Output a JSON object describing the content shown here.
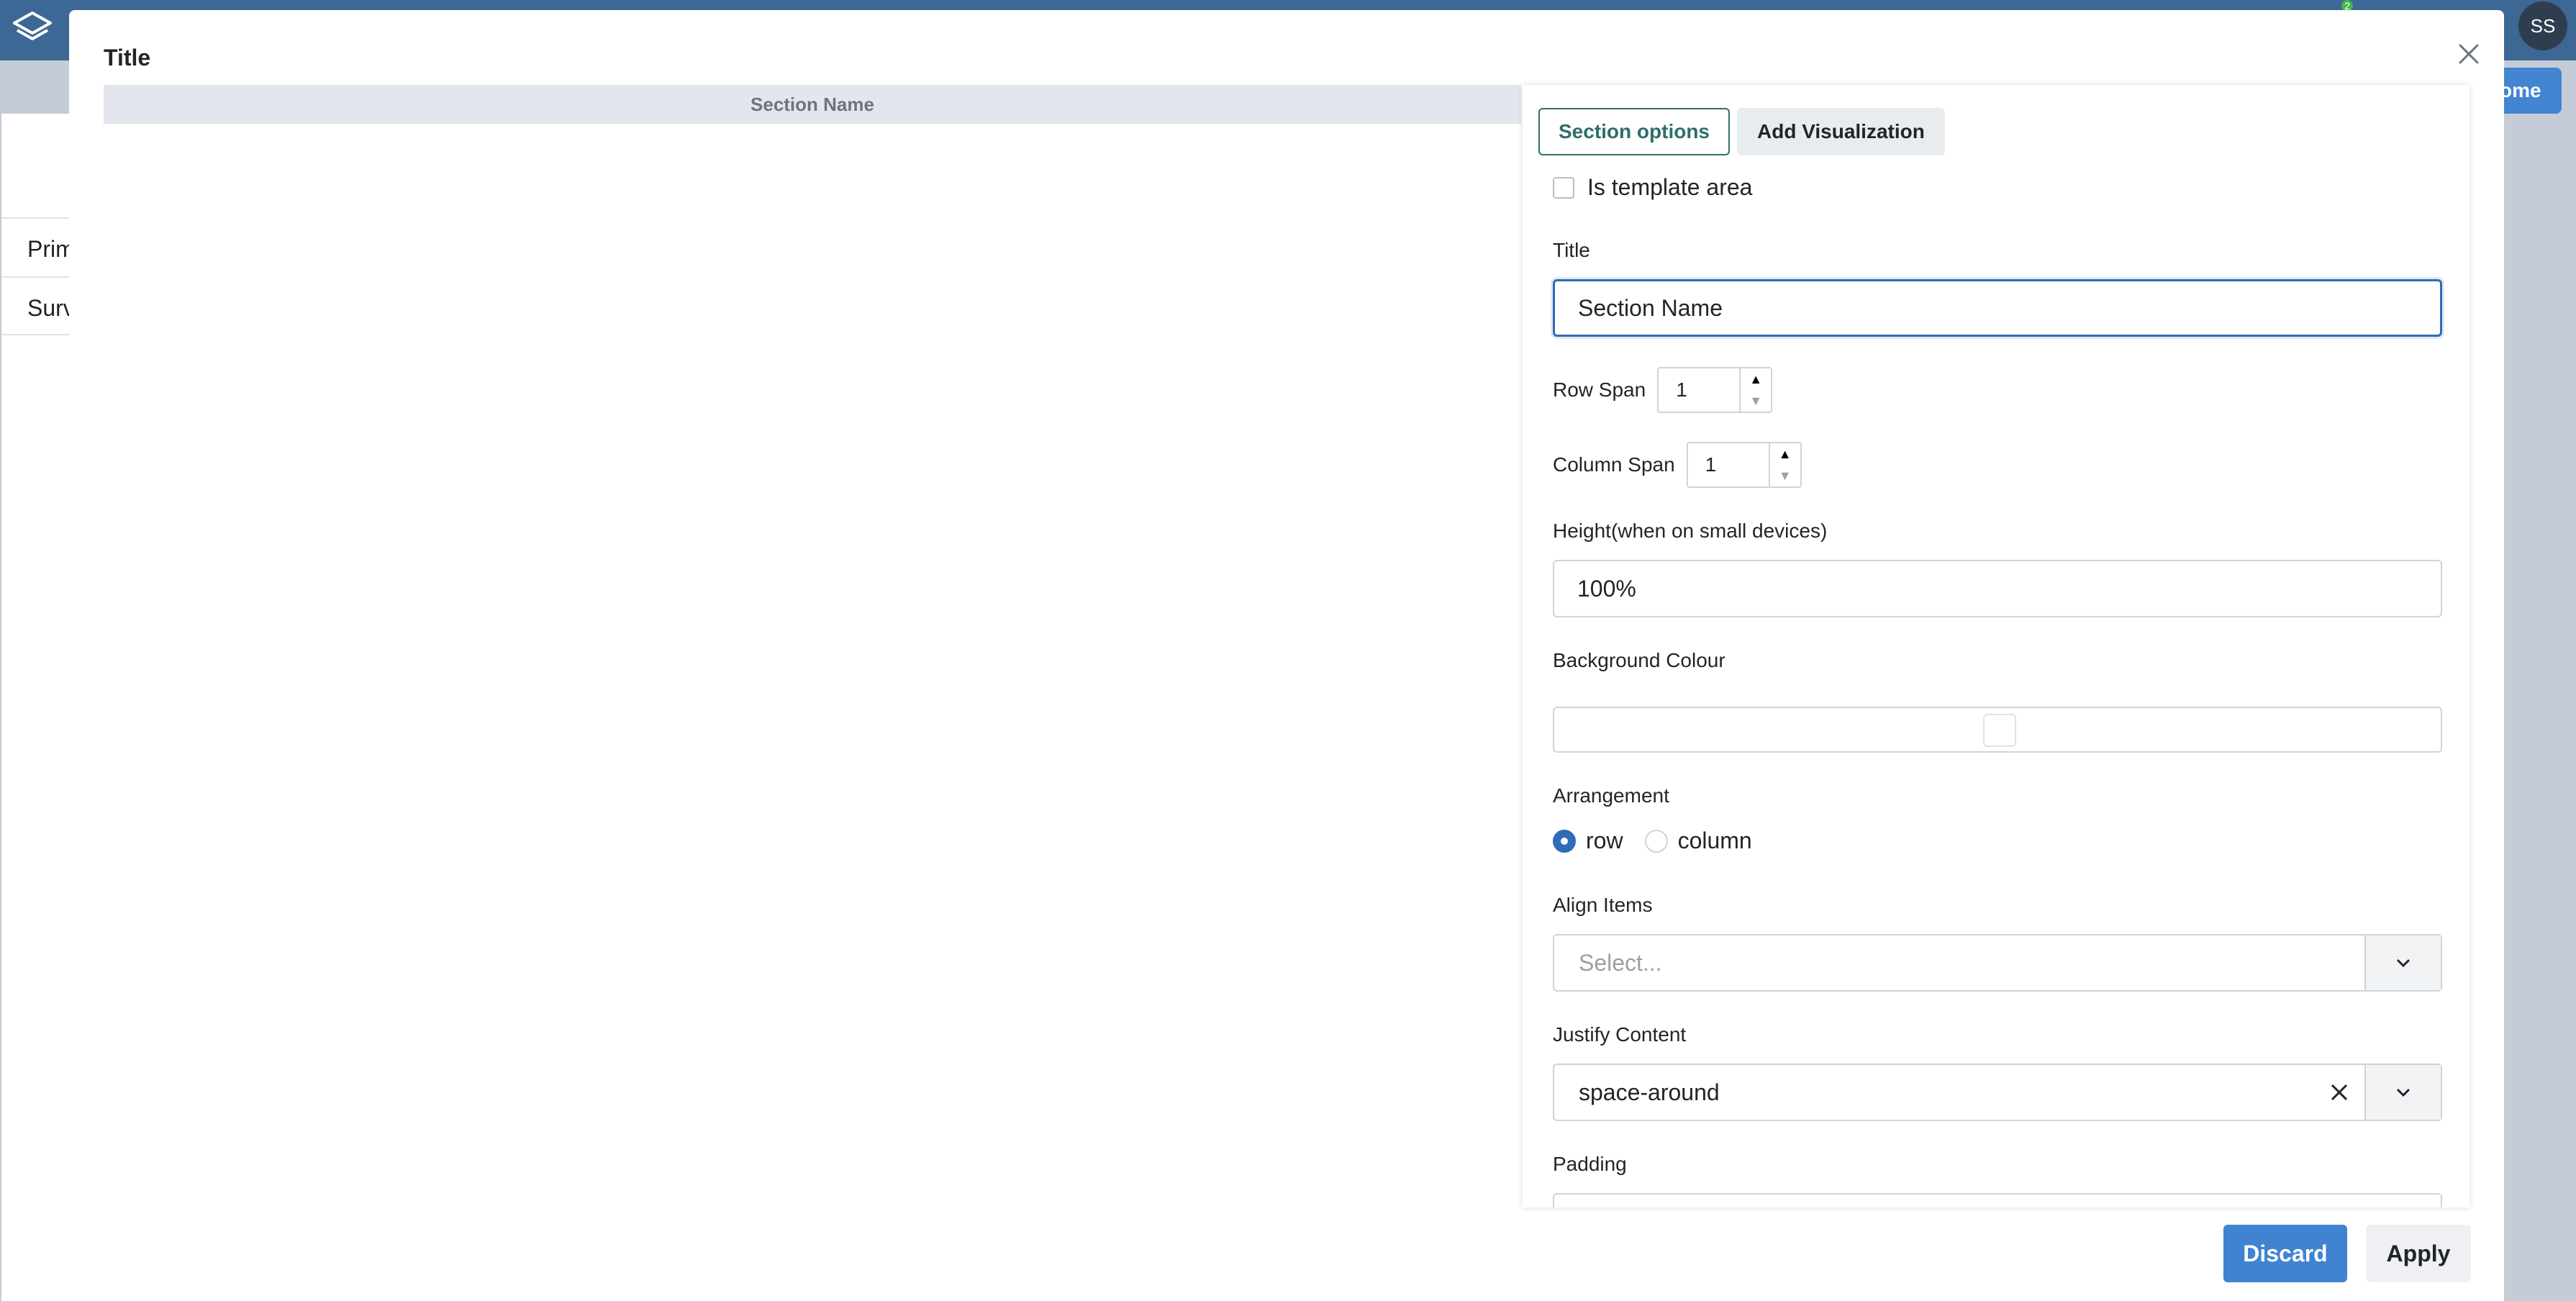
{
  "app": {
    "avatar_initials": "SS",
    "notification_count": "2",
    "header_button_label": "ome",
    "bg_rows": [
      "Prim",
      "Surv"
    ]
  },
  "modal": {
    "title": "Title",
    "section_header": "Section Name",
    "tabs": [
      {
        "label": "Section options",
        "active": true
      },
      {
        "label": "Add Visualization",
        "active": false
      }
    ],
    "is_template_area_label": "Is template area",
    "title_field": {
      "label": "Title",
      "value": "Section Name"
    },
    "row_span": {
      "label": "Row Span",
      "value": "1"
    },
    "column_span": {
      "label": "Column Span",
      "value": "1"
    },
    "height": {
      "label": "Height(when on small devices)",
      "value": "100%"
    },
    "background_colour": {
      "label": "Background Colour",
      "value": "#ffffff"
    },
    "arrangement": {
      "label": "Arrangement",
      "options": [
        "row",
        "column"
      ],
      "selected": "row"
    },
    "align_items": {
      "label": "Align Items",
      "placeholder": "Select..."
    },
    "justify_content": {
      "label": "Justify Content",
      "value": "space-around"
    },
    "padding": {
      "label": "Padding"
    },
    "buttons": {
      "discard": "Discard",
      "apply": "Apply"
    }
  },
  "colors": {
    "topbar": "#3d6795",
    "primary_button": "#3f83d1",
    "tab_active": "#2e6e6a",
    "focus_border": "#2e6cb8"
  }
}
